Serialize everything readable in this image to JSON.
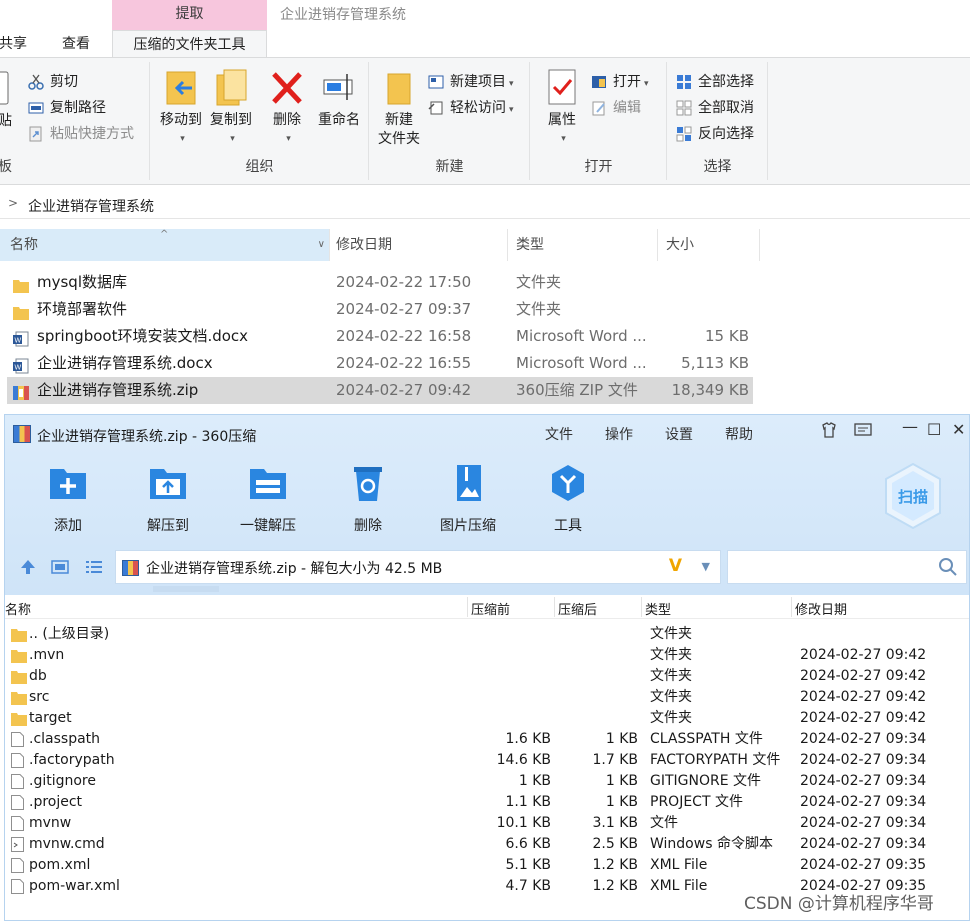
{
  "explorer": {
    "context_tab": "提取",
    "window_title": "企业进销存管理系统",
    "tabs": [
      "共享",
      "查看",
      "压缩的文件夹工具"
    ],
    "ribbon": {
      "clipboard": {
        "paste_partial": "贴",
        "cut": "剪切",
        "copy_path": "复制路径",
        "paste_shortcut": "粘贴快捷方式",
        "group_label": "板"
      },
      "organize": {
        "move_to": "移动到",
        "copy_to": "复制到",
        "delete": "删除",
        "rename": "重命名",
        "group_label": "组织"
      },
      "new": {
        "new_folder_line1": "新建",
        "new_folder_line2": "文件夹",
        "new_item": "新建项目",
        "easy_access": "轻松访问",
        "group_label": "新建"
      },
      "open": {
        "properties": "属性",
        "open": "打开",
        "edit": "编辑",
        "group_label": "打开"
      },
      "select": {
        "select_all": "全部选择",
        "select_none": "全部取消",
        "invert": "反向选择",
        "group_label": "选择"
      }
    },
    "breadcrumb": "企业进销存管理系统",
    "columns": [
      "名称",
      "修改日期",
      "类型",
      "大小"
    ],
    "files": [
      {
        "name": "mysql数据库",
        "date": "2024-02-22 17:50",
        "type": "文件夹",
        "size": "",
        "icon": "folder-icon"
      },
      {
        "name": "环境部署软件",
        "date": "2024-02-27 09:37",
        "type": "文件夹",
        "size": "",
        "icon": "folder-icon"
      },
      {
        "name": "springboot环境安装文档.docx",
        "date": "2024-02-22 16:58",
        "type": "Microsoft Word ...",
        "size": "15 KB",
        "icon": "word-doc-icon"
      },
      {
        "name": "企业进销存管理系统.docx",
        "date": "2024-02-22 16:55",
        "type": "Microsoft Word ...",
        "size": "5,113 KB",
        "icon": "word-doc-icon"
      },
      {
        "name": "企业进销存管理系统.zip",
        "date": "2024-02-27 09:42",
        "type": "360压缩 ZIP 文件",
        "size": "18,349 KB",
        "icon": "zip-icon"
      }
    ]
  },
  "zip": {
    "title": "企业进销存管理系统.zip - 360压缩",
    "menu": [
      "文件",
      "操作",
      "设置",
      "帮助"
    ],
    "tools": [
      "添加",
      "解压到",
      "一键解压",
      "删除",
      "图片压缩",
      "工具"
    ],
    "scan": "扫描",
    "path": "企业进销存管理系统.zip - 解包大小为 42.5 MB",
    "columns": [
      "名称",
      "压缩前",
      "压缩后",
      "类型",
      "修改日期"
    ],
    "rows": [
      {
        "name": ".. (上级目录)",
        "before": "",
        "after": "",
        "type": "文件夹",
        "date": "",
        "icon": "folder-icon"
      },
      {
        "name": ".mvn",
        "before": "",
        "after": "",
        "type": "文件夹",
        "date": "2024-02-27 09:42",
        "icon": "folder-icon"
      },
      {
        "name": "db",
        "before": "",
        "after": "",
        "type": "文件夹",
        "date": "2024-02-27 09:42",
        "icon": "folder-icon"
      },
      {
        "name": "src",
        "before": "",
        "after": "",
        "type": "文件夹",
        "date": "2024-02-27 09:42",
        "icon": "folder-icon"
      },
      {
        "name": "target",
        "before": "",
        "after": "",
        "type": "文件夹",
        "date": "2024-02-27 09:42",
        "icon": "folder-icon"
      },
      {
        "name": ".classpath",
        "before": "1.6 KB",
        "after": "1 KB",
        "type": "CLASSPATH 文件",
        "date": "2024-02-27 09:34",
        "icon": "file-icon"
      },
      {
        "name": ".factorypath",
        "before": "14.6 KB",
        "after": "1.7 KB",
        "type": "FACTORYPATH 文件",
        "date": "2024-02-27 09:34",
        "icon": "file-icon"
      },
      {
        "name": ".gitignore",
        "before": "1 KB",
        "after": "1 KB",
        "type": "GITIGNORE 文件",
        "date": "2024-02-27 09:34",
        "icon": "file-icon"
      },
      {
        "name": ".project",
        "before": "1.1 KB",
        "after": "1 KB",
        "type": "PROJECT 文件",
        "date": "2024-02-27 09:34",
        "icon": "file-icon"
      },
      {
        "name": "mvnw",
        "before": "10.1 KB",
        "after": "3.1 KB",
        "type": "文件",
        "date": "2024-02-27 09:34",
        "icon": "file-icon"
      },
      {
        "name": "mvnw.cmd",
        "before": "6.6 KB",
        "after": "2.5 KB",
        "type": "Windows 命令脚本",
        "date": "2024-02-27 09:34",
        "icon": "script-icon"
      },
      {
        "name": "pom.xml",
        "before": "5.1 KB",
        "after": "1.2 KB",
        "type": "XML File",
        "date": "2024-02-27 09:35",
        "icon": "file-icon"
      },
      {
        "name": "pom-war.xml",
        "before": "4.7 KB",
        "after": "1.2 KB",
        "type": "XML File",
        "date": "2024-02-27 09:35",
        "icon": "file-icon"
      }
    ]
  },
  "watermark": "CSDN @计算机程序华哥"
}
